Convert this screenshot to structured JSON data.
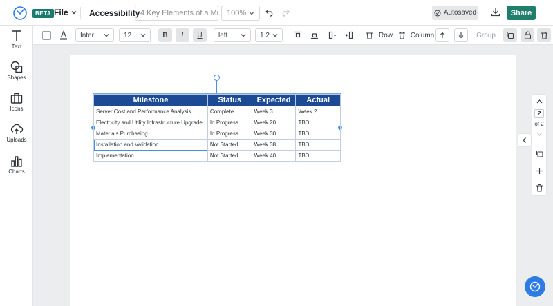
{
  "header": {
    "beta_label": "BETA",
    "file_label": "File",
    "accessibility_label": "Accessibility",
    "doc_title": "4 Key Elements of a Micr...",
    "zoom": "100%",
    "autosaved_label": "Autosaved",
    "share_label": "Share"
  },
  "sidebar": {
    "items": [
      {
        "label": "Text",
        "icon": "text-icon"
      },
      {
        "label": "Shapes",
        "icon": "shapes-icon"
      },
      {
        "label": "Icons",
        "icon": "briefcase-icon"
      },
      {
        "label": "Uploads",
        "icon": "upload-cloud-icon"
      },
      {
        "label": "Charts",
        "icon": "bar-chart-icon"
      }
    ]
  },
  "toolbar": {
    "font_family": "Inter",
    "font_size": "12",
    "bold": "B",
    "italic": "I",
    "underline": "U",
    "align": "left",
    "line_height": "1.2",
    "row_label": "Row",
    "column_label": "Column",
    "group_label": "Group"
  },
  "table": {
    "headers": [
      "Milestone",
      "Status",
      "Expected",
      "Actual"
    ],
    "rows": [
      [
        "Server Cost and Performance Analysis",
        "Complete",
        "Week 3",
        "Week 2"
      ],
      [
        "Electricity and Utility Infrastructure Upgrade",
        "In Progress",
        "Week 20",
        "TBD"
      ],
      [
        "Materials Purchasing",
        "In Progress",
        "Week 30",
        "TBD"
      ],
      [
        "Installation and Validation",
        "Not Started",
        "Week 38",
        "TBD"
      ],
      [
        "Implementation",
        "Not Started",
        "Week 40",
        "TBD"
      ]
    ]
  },
  "pager": {
    "current": "2",
    "of_label": "of 2"
  },
  "colors": {
    "brand_green": "#1f7e6c",
    "table_header": "#1c4a94",
    "selection_blue": "#4a90d9",
    "help_blue": "#2d7be5"
  }
}
